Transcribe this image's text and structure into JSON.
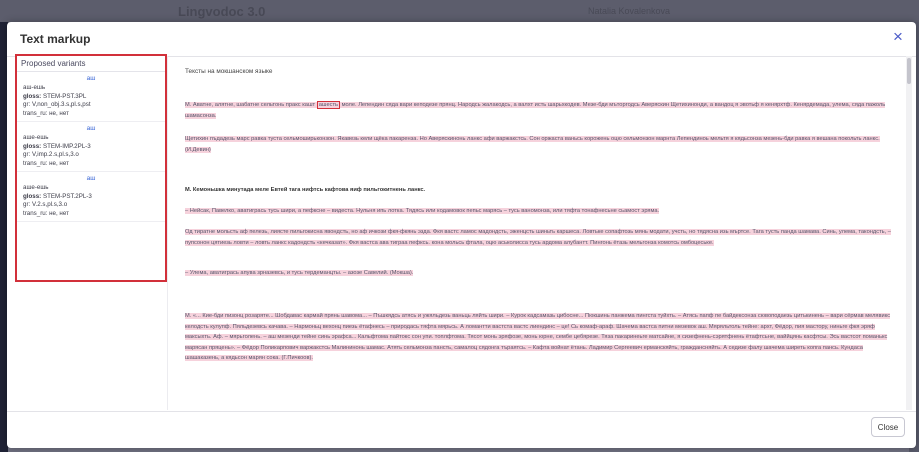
{
  "background": {
    "app_title": "Lingvodoc 3.0",
    "user": "Natalia Kovalenkova"
  },
  "modal": {
    "title": "Text markup",
    "close_icon": "×",
    "close_button": "Close"
  },
  "variants_panel": {
    "title": "Proposed variants",
    "variants": [
      {
        "head": "аш",
        "form": "аш-ешь",
        "gloss_label": "gloss:",
        "gloss": "STEM-PST.3PL",
        "gr": "gr: V,non_obj.3.s,pl.s,pst",
        "trans": "trans_ru: не, нет"
      },
      {
        "head": "аш",
        "form": "аше-ешь",
        "gloss_label": "gloss:",
        "gloss": "STEM-IMP.2PL-3",
        "gr": "gr: V,imp.2.s,pl.s,3.o",
        "trans": "trans_ru: не, нет"
      },
      {
        "head": "аш",
        "form": "аше-ешь",
        "gloss_label": "gloss:",
        "gloss": "STEM-PST.2PL-3",
        "gr": "gr: V.2.s,pl.s,3.o",
        "trans": "trans_ru: не, нет"
      }
    ]
  },
  "content": {
    "section_title": "Тексты на мокшанском языке",
    "para1_a": "М. Аватне, алятне, шабатне сельтонь пракс кашт ",
    "para1_boxed": "ашесть",
    "para1_b": " моле. Лепендин сяда вари кеподезе прянц. Народсь жалакодсь, а валхт исть шарьхкодев. Мезе-бди мъторгодсь Аверяскин Щетихинонди, а вандоц я эвотьф я кенярхтф. Кенярдемада, улема, сяда пажоль шамасонза.",
    "para2": "Щетихин пъдадезь марс равка тустa сельмоширьконзон. Якавезь кели щёка пакаренза. Но Аверяскинонь ланкс афи варжакстсь. Сон оржаста ваньсь корожень оцю сельмонзон марнта Лепендиноь мельтя я кядьсонза мезень-бди равка я вешана покольть ланкс. (И.Девин)",
    "para3_title": "М. Кемоньшка минутада меле Евтей тага нифтсь кафтова яиф пильгокитнень ланкс.",
    "para3_l1": "– Нейсак, Павелко, аватигрась тусь шири, а пефксне – видеста. Нульня ипь лотка. Тядясь или кодамовок пепьс марясь – тусь ваномонза, или тяфта тонафнесьне сьамост эряма.",
    "para3_l2": "Од тиратне мольсть аф пелезь, лиясте пильгокисна явондсть, но аф ичкози фкя-фкянь эзда. Фкя вастс ламос мадондсть, эженцсть шиньть каршеса. Ловтьке сопафтозь мянь модати, учсть, но тядясна изь мъртсе. Тага тусть панда шамава. Синь, улема, такондсть, – пупсонон цятиезь ловти – ловть ланкс кадондсть «кечказат». Фкя вастса ава тиграа пефксь. кона мольсь фтала, оцю аськолисса тусь ардома алубантт. Пингонь ётазь мельгонза комотсь омбоцеське.",
    "para3_l3": "– Улема, аватигрась апува зрназевсь, и тусь тердеманцты. – азозе Савелий. (Мокша).",
    "para4": "М. «... Кие-бди пизонц розаряте... Шобдавас кармай прянь шавома... – Пъшкядсь атясь и ужяльдезь ваньць ляйть шири. – Курок кадсамазь цибосне... Пюкшинь панжема пингста туйхть. – Атясь папф пе байдексонза сювоподаезь цитькинень – вари сёрмав мелявикс келодсть кулупф. Пяльдезевсь качава. – Нармоньц вехонц пиезь ётафнесь – природась тяфта мярьсь. А ломантти вастста вастс лиендинс – це! Сь комаф-араф. Шачема вастса питни мезевок аш. Мяряльтоль тейне: архт, Фёдор, пия мастору, ниньге фкя эряф максыхть. Аф. – мярьголень. – аш мезенди тейне синь эрафса... Кальфтома пайтокс сон упи. топлфтома. Тясот монь эряфозе, монь юрне, сембе цебярезе. Тяза пакаринеьге матсайне, я сизефнень-сэрятфнень ётафтсьне, ваййцянь касфтсы. Эсь вастсот поманькс марясан пряцень». – Фёдор Поликарпович варжакстсь Малининонь шамас. Атять сельмонза пансть, самалоц сядонга търаятсь. – Кафта войнат ётань. Ладимир Сергеевич ерманскяйть, граждансняйть. А седизе фалу шачема ширеть копга пансь. Кундаса шашаказень, а кядьсон марян сока. (Г.Пичкоов)."
  },
  "colors": {
    "accent": "#4a5ac8",
    "highlight": "#f6d2dc",
    "box_border": "#d2303a"
  },
  "icons": {
    "close": "close-icon"
  }
}
